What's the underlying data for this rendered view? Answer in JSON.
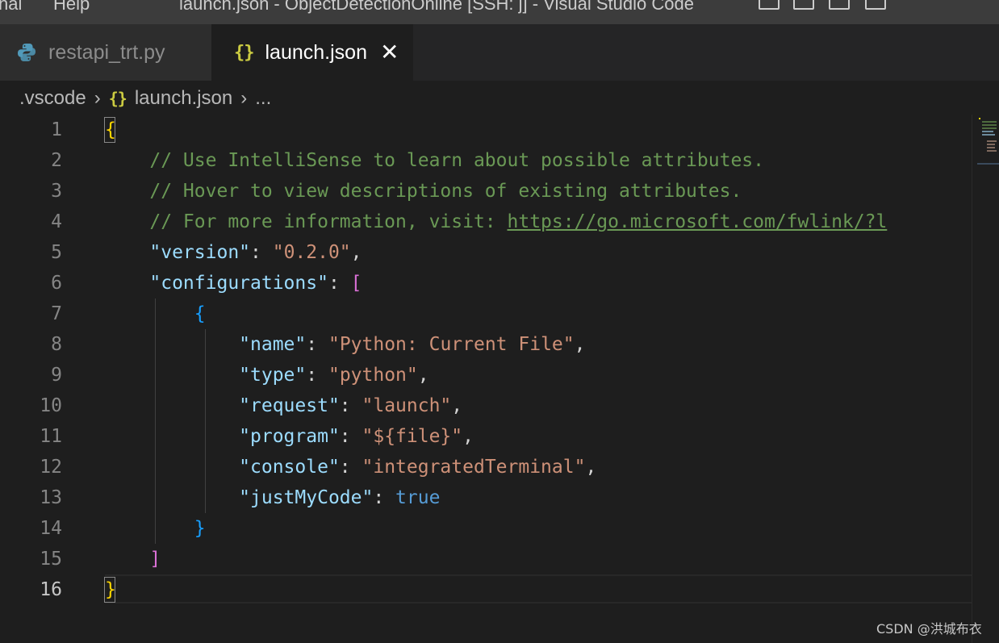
{
  "titlebar": {
    "menu_terminal": "nal",
    "menu_help": "Help",
    "window_title": "launch.json - ObjectDetectionOnline [SSH: j] - Visual Studio Code"
  },
  "tabs": [
    {
      "label": "restapi_trt.py",
      "icon": "python-icon",
      "active": false
    },
    {
      "label": "launch.json",
      "icon": "json-braces-icon",
      "active": true
    }
  ],
  "icons": {
    "json_braces": "{}",
    "close": "✕",
    "chevron": "›"
  },
  "breadcrumb": {
    "folder": ".vscode",
    "file": "launch.json",
    "tail": "..."
  },
  "editor": {
    "current_line": 16,
    "line_numbers": [
      "1",
      "2",
      "3",
      "4",
      "5",
      "6",
      "7",
      "8",
      "9",
      "10",
      "11",
      "12",
      "13",
      "14",
      "15",
      "16"
    ],
    "lines": {
      "l1_open": "{",
      "l2_comment": "// Use IntelliSense to learn about possible attributes.",
      "l3_comment": "// Hover to view descriptions of existing attributes.",
      "l4_comment": "// For more information, visit: ",
      "l4_link": "https://go.microsoft.com/fwlink/?l",
      "l5_key": "\"version\"",
      "l5_value": "\"0.2.0\"",
      "l6_key": "\"configurations\"",
      "l6_bracket": "[",
      "l7_open": "{",
      "l8_key": "\"name\"",
      "l8_value": "\"Python: Current File\"",
      "l9_key": "\"type\"",
      "l9_value": "\"python\"",
      "l10_key": "\"request\"",
      "l10_value": "\"launch\"",
      "l11_key": "\"program\"",
      "l11_value": "\"${file}\"",
      "l12_key": "\"console\"",
      "l12_value": "\"integratedTerminal\"",
      "l13_key": "\"justMyCode\"",
      "l13_value": "true",
      "l14_close": "}",
      "l15_bracket": "]",
      "l16_close": "}"
    }
  },
  "colors": {
    "comment": "#6a9955",
    "key": "#9cdcfe",
    "string": "#ce9178",
    "boolean": "#569cd6",
    "brace_level1": "#ffd700",
    "brace_level2": "#da70d6",
    "brace_level3": "#179fff"
  },
  "watermark": "CSDN @洪城布衣"
}
